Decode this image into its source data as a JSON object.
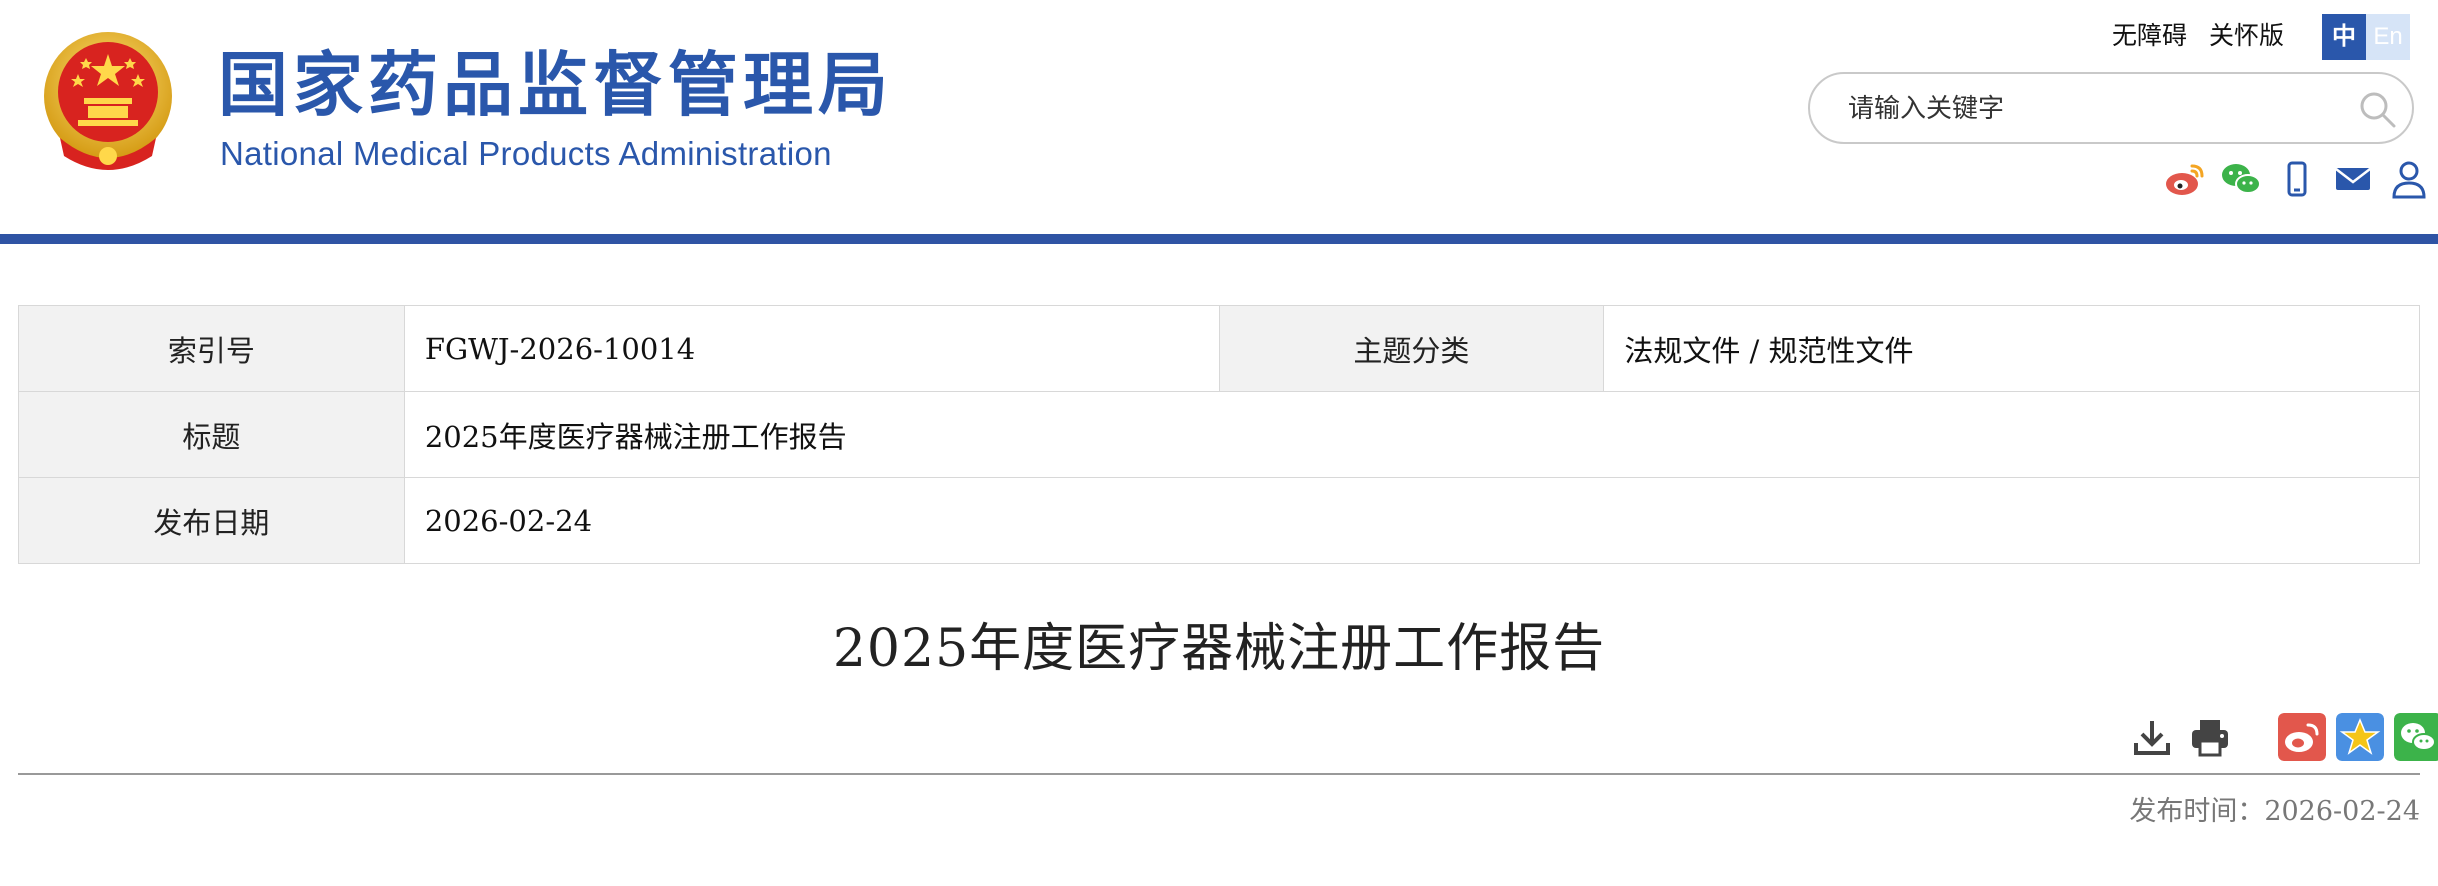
{
  "header": {
    "title_cn": "国家药品监督管理局",
    "title_en": "National Medical Products Administration",
    "top_links": [
      "无障碍",
      "关怀版"
    ],
    "lang": {
      "cn": "中",
      "en": "En"
    },
    "search": {
      "placeholder": "请输入关键字"
    },
    "social_icons": [
      "weibo-icon",
      "wechat-icon",
      "mobile-icon",
      "mail-icon",
      "user-icon"
    ]
  },
  "meta": {
    "index_label": "索引号",
    "index_value": "FGWJ-2026-10014",
    "topic_label": "主题分类",
    "topic_value": "法规文件 / 规范性文件",
    "title_label": "标题",
    "title_value": "2025年度医疗器械注册工作报告",
    "date_label": "发布日期",
    "date_value": "2026-02-24"
  },
  "article": {
    "title": "2025年度医疗器械注册工作报告",
    "publish_label": "发布时间：",
    "publish_date": "2026-02-24"
  },
  "colors": {
    "brand": "#2a57ab",
    "bar": "#2f54a4",
    "weibo": "#e2574c",
    "favorite": "#4a90e2",
    "wechat": "#3cb34a"
  }
}
